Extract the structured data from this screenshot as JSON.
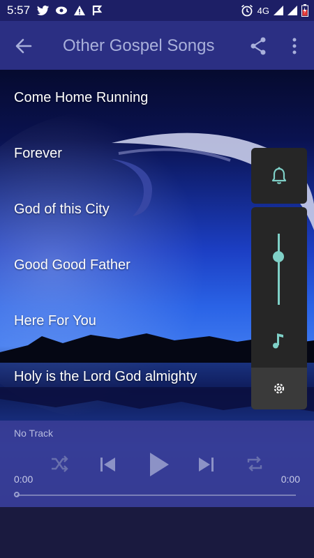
{
  "status_bar": {
    "time": "5:57",
    "network": "4G"
  },
  "app_bar": {
    "title": "Other Gospel Songs"
  },
  "songs": [
    "Come Home Running",
    "Forever",
    "God of this City",
    "Good Good Father",
    "Here For You",
    "Holy is the Lord God almighty"
  ],
  "volume_panel": {
    "media_volume_level": 0.68,
    "accent_color": "#7fd0c7"
  },
  "player": {
    "track": "No Track",
    "elapsed": "0:00",
    "duration": "0:00",
    "progress": 0
  },
  "colors": {
    "app_bar": "#2b2f83",
    "status_bar": "#1d1f66",
    "player_bar": "#3a3e96"
  }
}
